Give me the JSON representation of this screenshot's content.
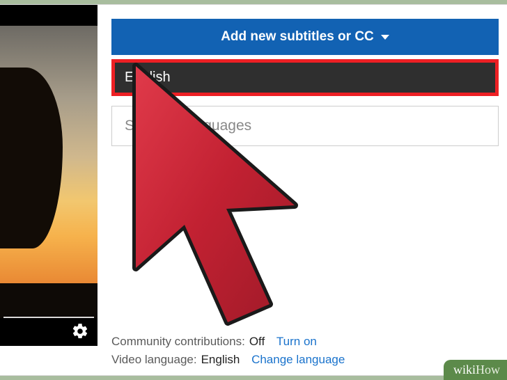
{
  "header": {
    "add_button_label": "Add new subtitles or CC"
  },
  "dropdown": {
    "selected": "English",
    "search_placeholder": "Search 1           anguages"
  },
  "meta": {
    "community_label": "Community contributions:",
    "community_value": "Off",
    "community_link": "Turn on",
    "language_label": "Video language:",
    "language_value": "English",
    "language_link": "Change language"
  },
  "branding": {
    "wiki": "wiki",
    "how": "How"
  }
}
